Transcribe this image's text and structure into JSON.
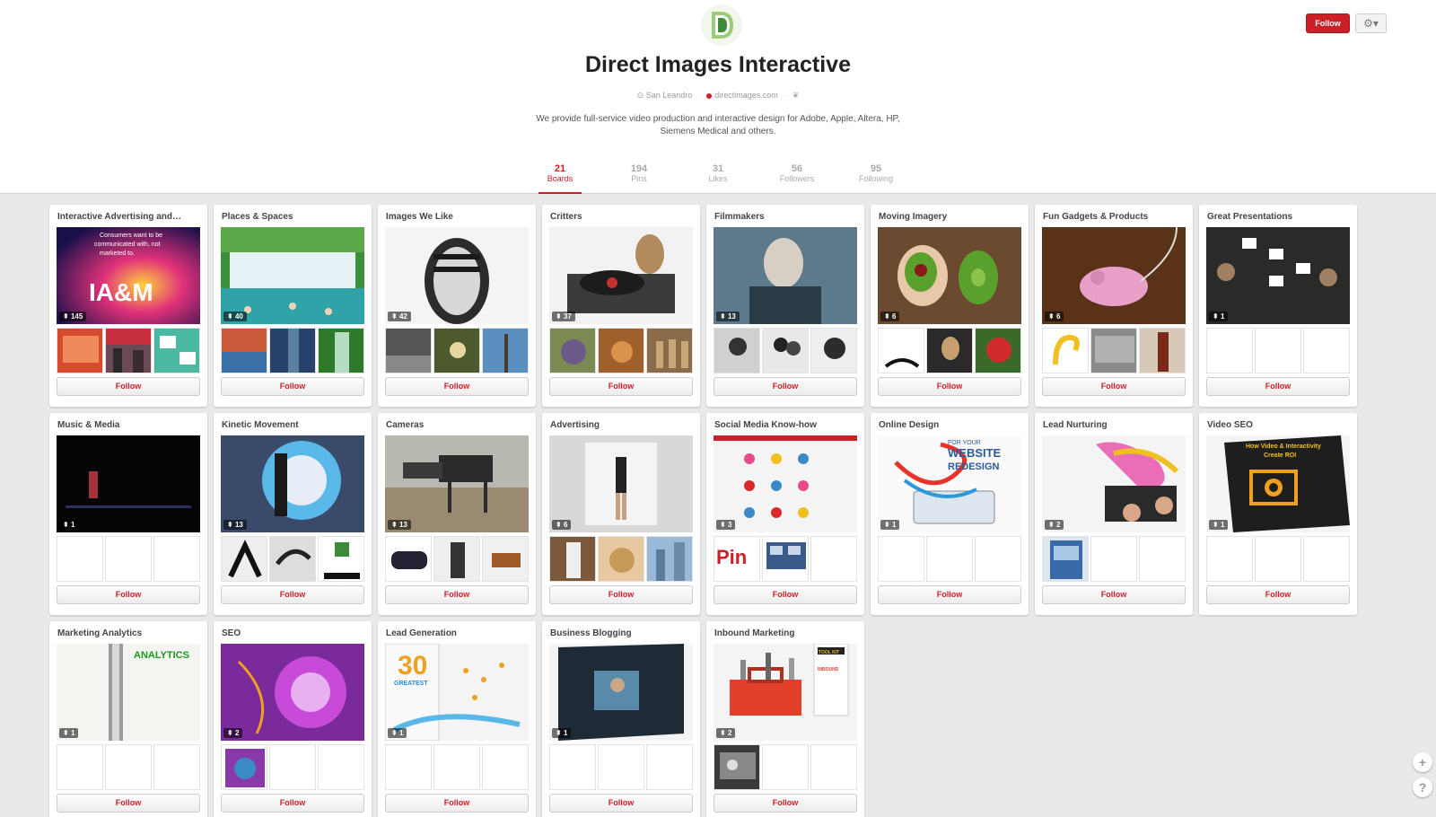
{
  "profile": {
    "name": "Direct Images Interactive",
    "location": "San Leandro",
    "website": "directimages.com",
    "description": "We provide full-service video production and interactive design for Adobe, Apple, Altera, HP, Siemens Medical and others."
  },
  "header": {
    "follow_label": "Follow",
    "settings_glyph": "⚙▾",
    "logo_icon": "logo-icon",
    "location_icon": "pin-icon",
    "website_icon": "pinterest-icon",
    "twitter_icon": "twitter-icon"
  },
  "stats": [
    {
      "num": "21",
      "label": "Boards"
    },
    {
      "num": "194",
      "label": "Pins"
    },
    {
      "num": "31",
      "label": "Likes"
    },
    {
      "num": "56",
      "label": "Followers"
    },
    {
      "num": "95",
      "label": "Following"
    }
  ],
  "boards": [
    {
      "name": "Interactive Advertising and…",
      "count": "145",
      "follow": "Follow"
    },
    {
      "name": "Places & Spaces",
      "count": "40",
      "follow": "Follow"
    },
    {
      "name": "Images We Like",
      "count": "42",
      "follow": "Follow"
    },
    {
      "name": "Critters",
      "count": "37",
      "follow": "Follow"
    },
    {
      "name": "Filmmakers",
      "count": "13",
      "follow": "Follow"
    },
    {
      "name": "Moving Imagery",
      "count": "6",
      "follow": "Follow"
    },
    {
      "name": "Fun Gadgets & Products",
      "count": "6",
      "follow": "Follow"
    },
    {
      "name": "Great Presentations",
      "count": "1",
      "follow": "Follow"
    },
    {
      "name": "Music & Media",
      "count": "1",
      "follow": "Follow"
    },
    {
      "name": "Kinetic Movement",
      "count": "13",
      "follow": "Follow"
    },
    {
      "name": "Cameras",
      "count": "13",
      "follow": "Follow"
    },
    {
      "name": "Advertising",
      "count": "6",
      "follow": "Follow"
    },
    {
      "name": "Social Media Know-how",
      "count": "3",
      "follow": "Follow"
    },
    {
      "name": "Online Design",
      "count": "1",
      "follow": "Follow"
    },
    {
      "name": "Lead Nurturing",
      "count": "2",
      "follow": "Follow"
    },
    {
      "name": "Video SEO",
      "count": "1",
      "follow": "Follow"
    },
    {
      "name": "Marketing Analytics",
      "count": "1",
      "follow": "Follow"
    },
    {
      "name": "SEO",
      "count": "2",
      "follow": "Follow"
    },
    {
      "name": "Lead Generation",
      "count": "1",
      "follow": "Follow"
    },
    {
      "name": "Business Blogging",
      "count": "1",
      "follow": "Follow"
    },
    {
      "name": "Inbound Marketing",
      "count": "2",
      "follow": "Follow"
    }
  ],
  "cover_texts": {
    "b0_line1": "Consumers want to be",
    "b0_line2": "communicated with, not",
    "b0_line3": "marketed to.",
    "b0_big": "IA&M",
    "b13_line1": "FOR YOUR",
    "b13_line2": "WEBSITE",
    "b13_line3": "REDESIGN",
    "b15_line1": "How Video & Interactivity",
    "b15_line2": "Create ROI",
    "b16_big": "ANALYTICS",
    "b18_big": "30",
    "b18_sub": "GREATEST",
    "b20_tag": "TOOL KIT",
    "b20_line": "INBOUND"
  },
  "side_buttons": {
    "plus": "+",
    "help": "?"
  }
}
